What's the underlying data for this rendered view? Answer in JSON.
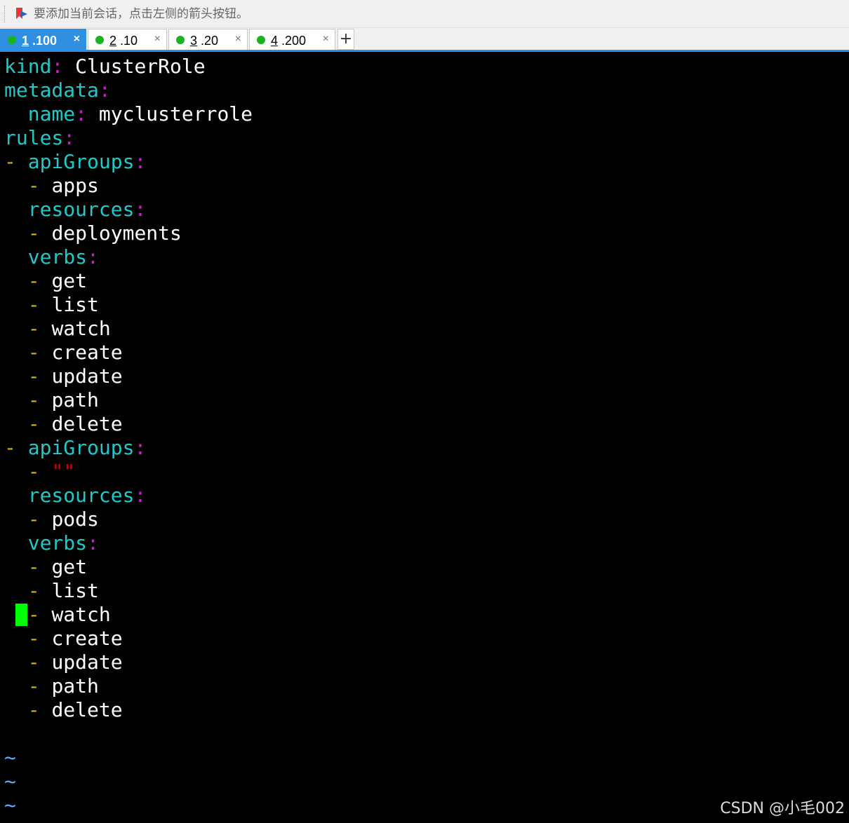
{
  "hint": {
    "text": "要添加当前会话，点击左侧的箭头按钮。",
    "icon": "bookmark-arrow-icon"
  },
  "tabs": [
    {
      "num": "1",
      "label": " .100",
      "active": true
    },
    {
      "num": "2",
      "label": " .10",
      "active": false
    },
    {
      "num": "3",
      "label": " .20",
      "active": false
    },
    {
      "num": "4",
      "label": " .200",
      "active": false
    }
  ],
  "tab_close_glyph": "×",
  "tab_add_glyph": "+",
  "colors": {
    "key": "#1fc9c9",
    "colon": "#c020c0",
    "dash": "#d8b000",
    "string": "#d00000",
    "tilde": "#5bb0ff",
    "cursor": "#00ff00",
    "active_tab": "#2f8fe0",
    "status_dot": "#17b41d"
  },
  "editor": {
    "lines": [
      "kind: ClusterRole",
      "metadata:",
      "  name: myclusterrole",
      "rules:",
      "- apiGroups:",
      "  - apps",
      "  resources:",
      "  - deployments",
      "  verbs:",
      "  - get",
      "  - list",
      "  - watch",
      "  - create",
      "  - update",
      "  - path",
      "  - delete",
      "- apiGroups:",
      "  - \"\"",
      "  resources:",
      "  - pods",
      "  verbs:",
      "  - get",
      "  - list",
      "  - watch",
      "  - create",
      "  - update",
      "  - path",
      "  - delete",
      "",
      "~",
      "~",
      "~"
    ],
    "cursor_line": 24
  },
  "watermark": "CSDN @小毛002"
}
